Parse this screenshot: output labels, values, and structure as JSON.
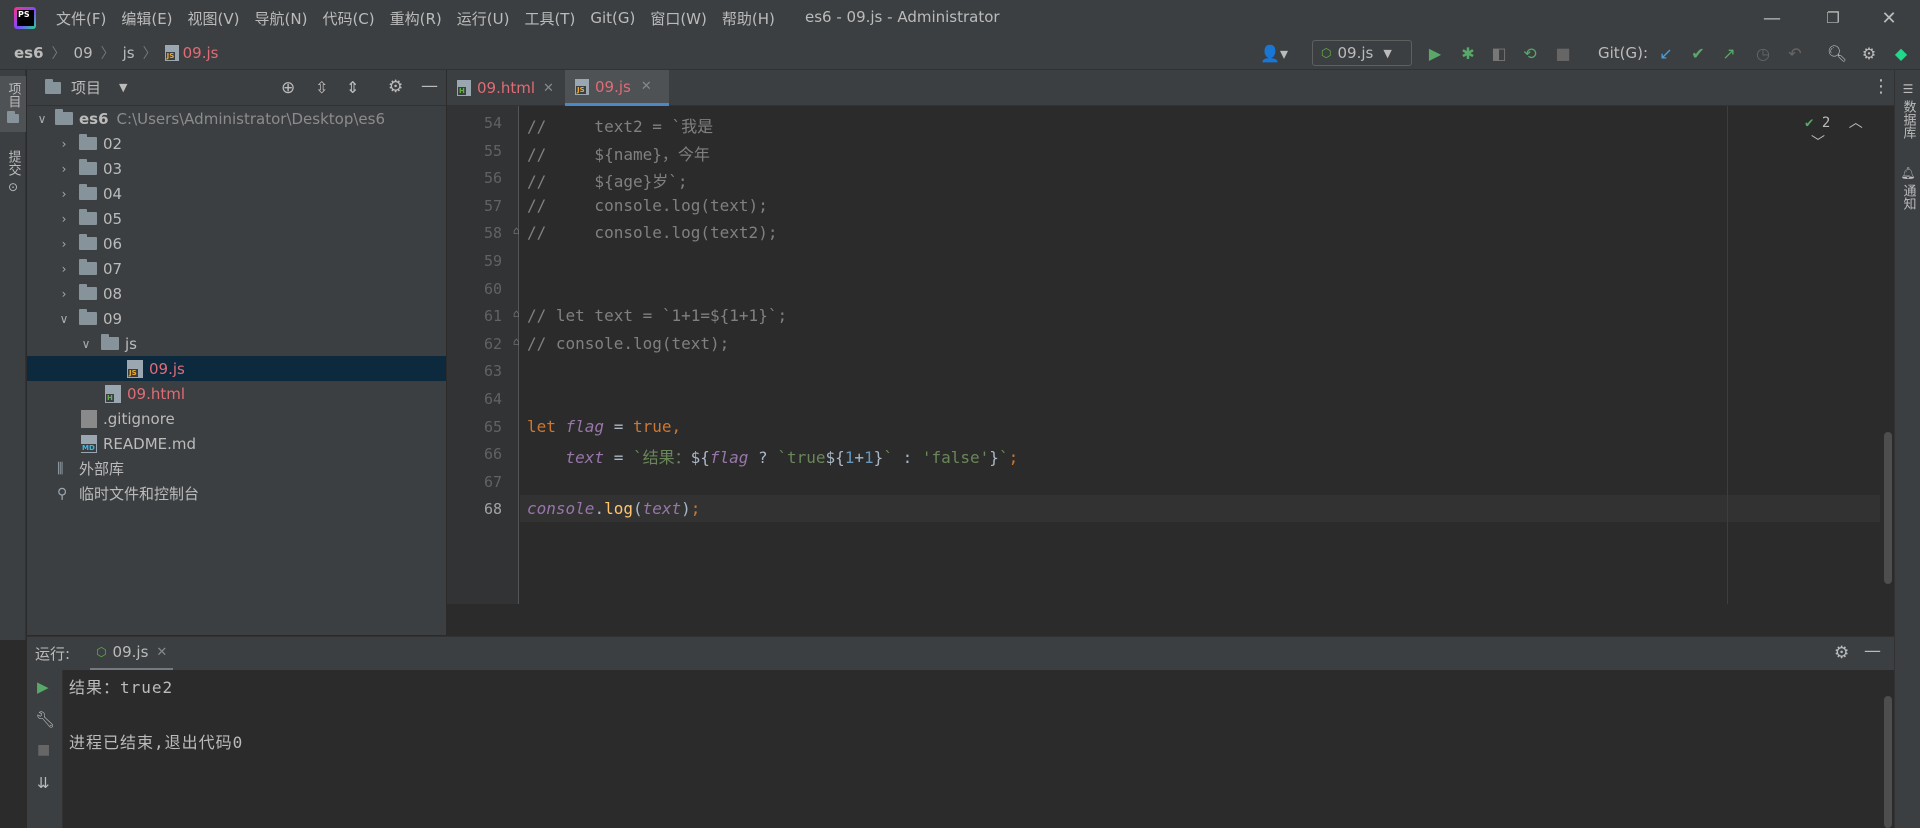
{
  "window": {
    "title": "es6 - 09.js - Administrator",
    "menu": [
      "文件(F)",
      "编辑(E)",
      "视图(V)",
      "导航(N)",
      "代码(C)",
      "重构(R)",
      "运行(U)",
      "工具(T)",
      "Git(G)",
      "窗口(W)",
      "帮助(H)"
    ],
    "controls": {
      "minimize": "—",
      "restore": "❐",
      "close": "✕"
    }
  },
  "breadcrumb": [
    "es6",
    "09",
    "js",
    "09.js"
  ],
  "toolbar": {
    "run_config": "09.js",
    "git_label": "Git(G):"
  },
  "left_strip": {
    "project": "项目",
    "commit": "提交"
  },
  "right_strip": {
    "database": "数据库",
    "notifications": "通知"
  },
  "project_panel": {
    "title": "项目",
    "root_name": "es6",
    "root_path": "C:\\Users\\Administrator\\Desktop\\es6",
    "folders": [
      "02",
      "03",
      "04",
      "05",
      "06",
      "07",
      "08",
      "09"
    ],
    "js_folder": "js",
    "files": {
      "js_file": "09.js",
      "html_file": "09.html",
      "gitignore": ".gitignore",
      "readme": "README.md"
    },
    "external_libs": "外部库",
    "scratches": "临时文件和控制台"
  },
  "editor": {
    "tabs": [
      {
        "label": "09.html",
        "active": false
      },
      {
        "label": "09.js",
        "active": true
      }
    ],
    "inspection_count": "2",
    "line_numbers": [
      "54",
      "55",
      "56",
      "57",
      "58",
      "59",
      "60",
      "61",
      "62",
      "63",
      "64",
      "65",
      "66",
      "67",
      "68"
    ],
    "current_line": "68"
  },
  "run_panel": {
    "label": "运行:",
    "tab": "09.js",
    "output_line1": "结果：true2",
    "output_line2": "进程已结束,退出代码0"
  },
  "colors": {
    "accent": "#4a88c7",
    "comment": "#808080",
    "keyword": "#cc7832",
    "string": "#6a8759",
    "variable": "#9876aa",
    "function": "#ffc66d",
    "number": "#6897bb"
  }
}
